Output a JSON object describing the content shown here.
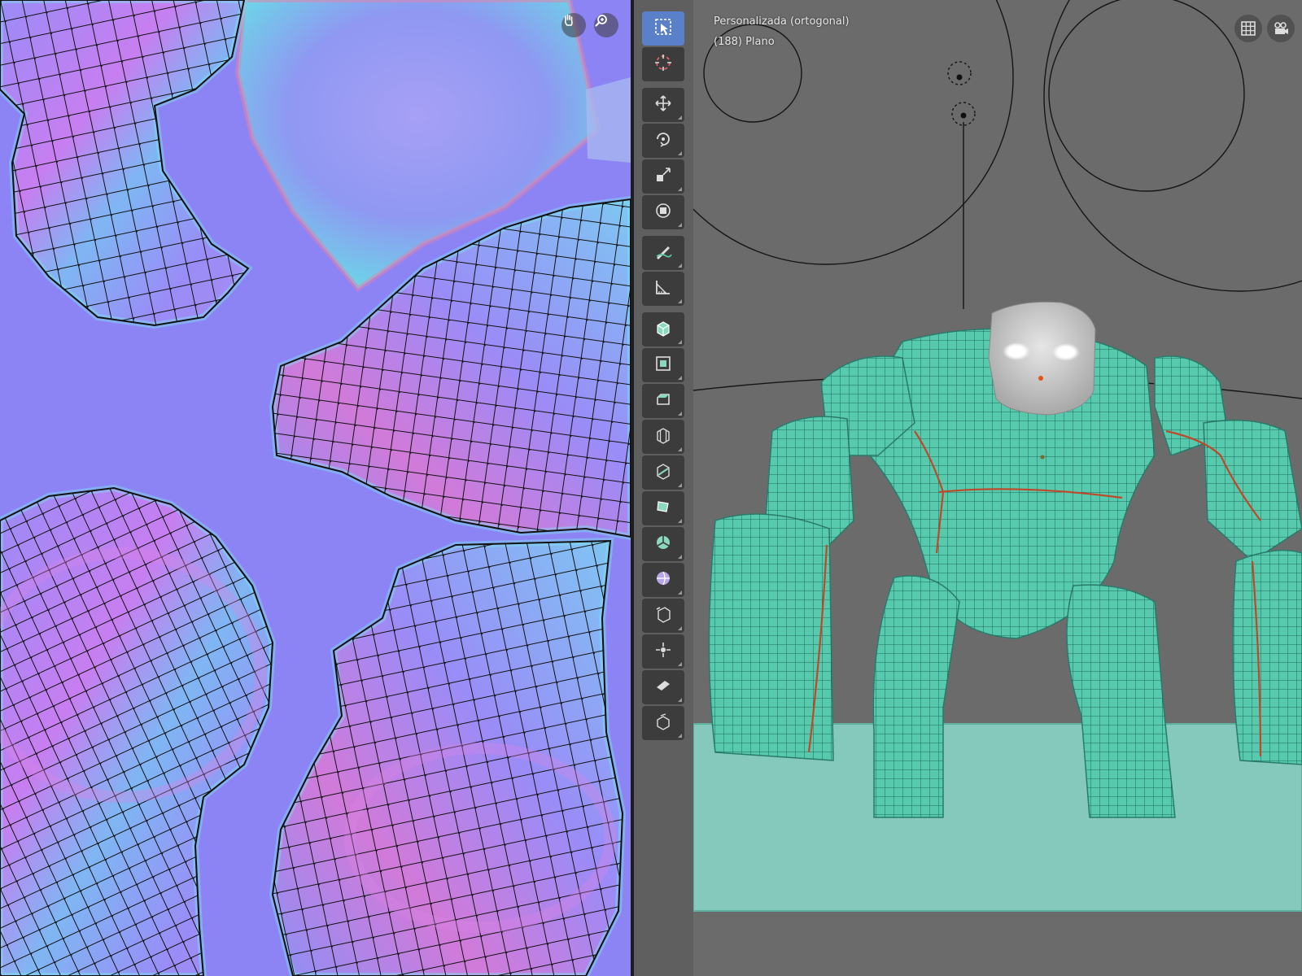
{
  "viewport": {
    "view_name": "Personalizada (ortogonal)",
    "object_info": "(188) Plano"
  },
  "uv_editor": {
    "gizmos": [
      {
        "icon": "hand-pan-icon"
      },
      {
        "icon": "zoom-magnifier-icon"
      }
    ]
  },
  "toolbar": {
    "tools": [
      {
        "name": "select-box",
        "icon": "select-box-icon",
        "active": true
      },
      {
        "name": "cursor",
        "icon": "cursor-icon",
        "active": false
      },
      {
        "name": "move",
        "icon": "move-icon",
        "active": false
      },
      {
        "name": "rotate",
        "icon": "rotate-icon",
        "active": false
      },
      {
        "name": "scale",
        "icon": "scale-icon",
        "active": false
      },
      {
        "name": "transform",
        "icon": "transform-icon",
        "active": false
      },
      {
        "name": "annotate",
        "icon": "annotate-icon",
        "active": false
      },
      {
        "name": "measure",
        "icon": "measure-icon",
        "active": false
      },
      {
        "name": "extrude",
        "icon": "extrude-icon",
        "active": false
      },
      {
        "name": "inset",
        "icon": "inset-icon",
        "active": false
      },
      {
        "name": "bevel",
        "icon": "bevel-icon",
        "active": false
      },
      {
        "name": "loop-cut",
        "icon": "loop-cut-icon",
        "active": false
      },
      {
        "name": "knife",
        "icon": "knife-icon",
        "active": false
      },
      {
        "name": "poly-build",
        "icon": "poly-build-icon",
        "active": false
      },
      {
        "name": "spin",
        "icon": "spin-icon",
        "active": false
      },
      {
        "name": "smooth",
        "icon": "smooth-icon",
        "active": false
      },
      {
        "name": "edge-slide",
        "icon": "edge-slide-icon",
        "active": false
      },
      {
        "name": "shrink-fatten",
        "icon": "shrink-fatten-icon",
        "active": false
      },
      {
        "name": "shear",
        "icon": "shear-icon",
        "active": false
      },
      {
        "name": "rip-region",
        "icon": "rip-region-icon",
        "active": false
      }
    ]
  },
  "view_buttons": [
    {
      "icon": "grid-toggle-icon"
    },
    {
      "icon": "camera-view-icon"
    }
  ],
  "colors": {
    "uv_background": "#8c84f4",
    "mesh": "#57c9ad",
    "floor": "#84c9bb",
    "seam": "#c0482a",
    "active_tool": "#5a80c9"
  }
}
